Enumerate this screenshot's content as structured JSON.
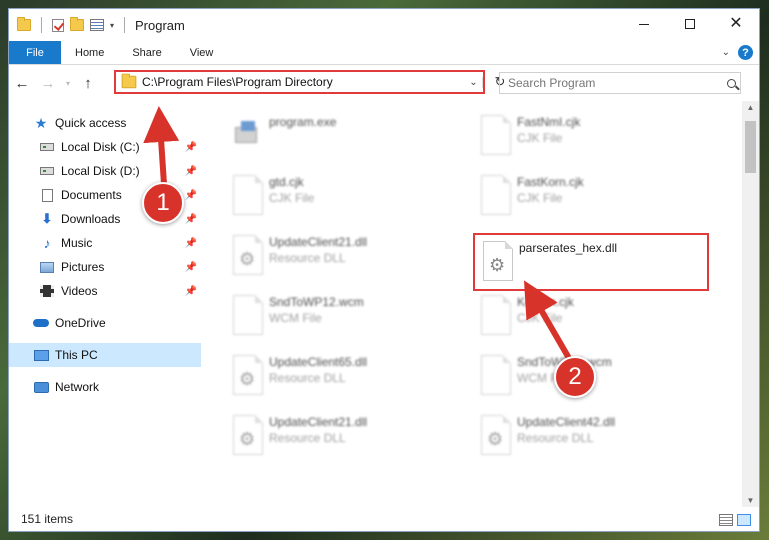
{
  "window": {
    "title": "Program",
    "controls": {
      "minimize": "—",
      "maximize": "☐",
      "close": "✕"
    }
  },
  "ribbon": {
    "tabs": [
      "File",
      "Home",
      "Share",
      "View"
    ],
    "help": "?"
  },
  "nav": {
    "address": "C:\\Program Files\\Program Directory",
    "search_placeholder": "Search Program"
  },
  "sidebar": {
    "items": [
      {
        "label": "Quick access",
        "icon": "star-icon"
      },
      {
        "label": "Local Disk (C:)",
        "icon": "disk-icon",
        "pinned": true
      },
      {
        "label": "Local Disk (D:)",
        "icon": "disk-icon",
        "pinned": true
      },
      {
        "label": "Documents",
        "icon": "document-icon",
        "pinned": true
      },
      {
        "label": "Downloads",
        "icon": "download-icon",
        "pinned": true
      },
      {
        "label": "Music",
        "icon": "music-icon",
        "pinned": true
      },
      {
        "label": "Pictures",
        "icon": "pictures-icon",
        "pinned": true
      },
      {
        "label": "Videos",
        "icon": "videos-icon",
        "pinned": true
      },
      {
        "label": "OneDrive",
        "icon": "onedrive-icon"
      },
      {
        "label": "This PC",
        "icon": "computer-icon",
        "selected": true
      },
      {
        "label": "Network",
        "icon": "network-icon"
      }
    ]
  },
  "files": [
    {
      "name": "program.exe",
      "type": ""
    },
    {
      "name": "FastNmI.cjk",
      "type": "CJK File"
    },
    {
      "name": "gtd.cjk",
      "type": "CJK File"
    },
    {
      "name": "FastKorn.cjk",
      "type": "CJK File"
    },
    {
      "name": "UpdateClient21.dll",
      "type": "Resource DLL"
    },
    {
      "name": "parserates_hex.dll",
      "type": ""
    },
    {
      "name": "SndToWP12.wcm",
      "type": "WCM File"
    },
    {
      "name": "Korean.cjk",
      "type": "CJK File"
    },
    {
      "name": "UpdateClient65.dll",
      "type": "Resource DLL"
    },
    {
      "name": "SndToWP16.wcm",
      "type": "WCM File"
    },
    {
      "name": "UpdateClient21.dll",
      "type": "Resource DLL"
    },
    {
      "name": "UpdateClient42.dll",
      "type": "Resource DLL"
    }
  ],
  "status": {
    "count": "151 items"
  },
  "annotations": {
    "step1": "1",
    "step2": "2"
  },
  "colors": {
    "accent": "#1979ca",
    "highlight": "#e03a3a",
    "selected": "#cce8ff"
  }
}
